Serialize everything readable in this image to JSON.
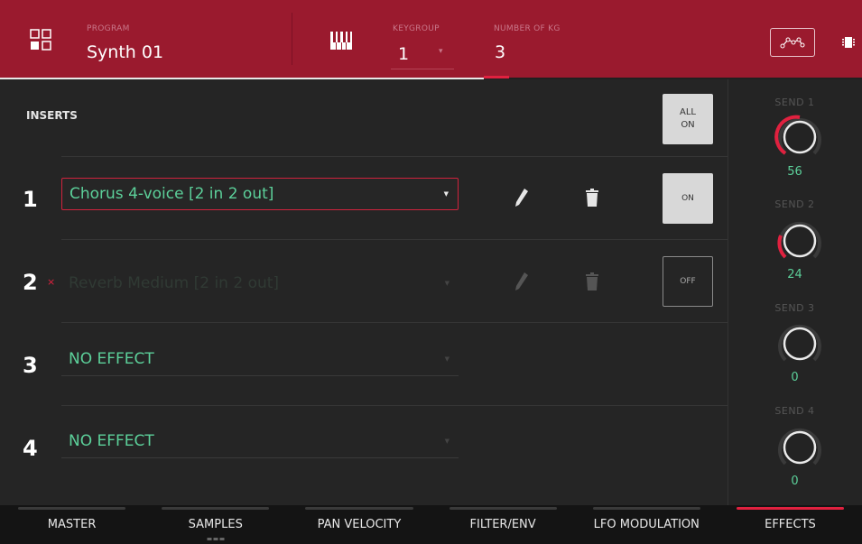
{
  "header": {
    "program_label": "PROGRAM",
    "program_value": "Synth 01",
    "keygroup_label": "KEYGROUP",
    "keygroup_value": "1",
    "number_kg_label": "NUMBER OF KG",
    "number_kg_value": "3",
    "icons": [
      "pads-icon",
      "keyboard-icon",
      "envelope-icon",
      "chip-icon"
    ]
  },
  "inserts": {
    "title": "INSERTS",
    "all_on_line1": "ALL",
    "all_on_line2": "ON",
    "slots": [
      {
        "num": "1",
        "effect": "Chorus 4-voice [2 in 2 out]",
        "button": "ON",
        "bypassed": false
      },
      {
        "num": "2",
        "effect": "Reverb Medium [2 in 2 out]",
        "button": "OFF",
        "bypassed": true,
        "bypass_mark": "×"
      },
      {
        "num": "3",
        "effect": "NO EFFECT"
      },
      {
        "num": "4",
        "effect": "NO EFFECT"
      }
    ]
  },
  "sends": [
    {
      "label": "SEND 1",
      "value": "56"
    },
    {
      "label": "SEND 2",
      "value": "24"
    },
    {
      "label": "SEND 3",
      "value": "0"
    },
    {
      "label": "SEND 4",
      "value": "0"
    }
  ],
  "tabs": [
    {
      "label": "MASTER"
    },
    {
      "label": "SAMPLES"
    },
    {
      "label": "PAN VELOCITY"
    },
    {
      "label": "FILTER/ENV"
    },
    {
      "label": "LFO MODULATION"
    },
    {
      "label": "EFFECTS"
    }
  ],
  "colors": {
    "header_bg": "#9a1a2e",
    "accent": "#e0213f",
    "effect_text": "#5cd09a"
  }
}
